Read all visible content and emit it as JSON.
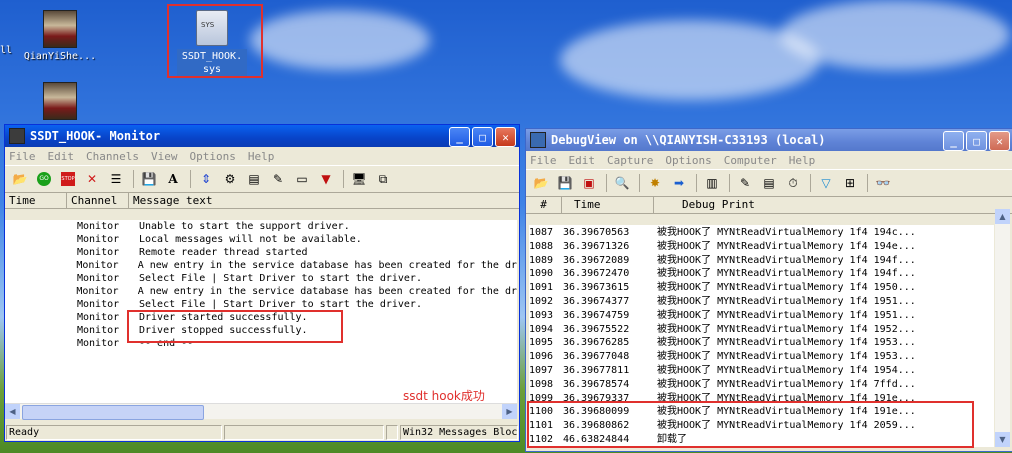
{
  "desktop": {
    "icons": [
      {
        "label": "QianYiShe..."
      },
      {
        "label": "SSDT_HOOK.sys"
      }
    ],
    "edge_label": "ll"
  },
  "monitor": {
    "title": "SSDT_HOOK- Monitor",
    "menu": [
      "File",
      "Edit",
      "Channels",
      "View",
      "Options",
      "Help"
    ],
    "columns": [
      "Time",
      "Channel",
      "Message text"
    ],
    "rows": [
      {
        "channel": "Monitor",
        "text": "Unable to start the support driver."
      },
      {
        "channel": "Monitor",
        "text": "Local messages will not be available."
      },
      {
        "channel": "Monitor",
        "text": "Remote reader thread started"
      },
      {
        "channel": "Monitor",
        "text": "A new entry in the service database has been created for the dr"
      },
      {
        "channel": "Monitor",
        "text": "Select File | Start Driver to start the driver."
      },
      {
        "channel": "Monitor",
        "text": "A new entry in the service database has been created for the dr"
      },
      {
        "channel": "Monitor",
        "text": "Select File | Start Driver to start the driver."
      },
      {
        "channel": "Monitor",
        "text": "Driver started successfully."
      },
      {
        "channel": "Monitor",
        "text": "Driver stopped successfully."
      },
      {
        "channel": "Monitor",
        "text": " -- end --"
      }
    ],
    "status": [
      "Ready",
      "",
      "",
      "Win32 Messages Bloc"
    ]
  },
  "annotation": "ssdt hook成功",
  "debugview": {
    "title": "DebugView on \\\\QIANYISH-C33193 (local)",
    "menu": [
      "File",
      "Edit",
      "Capture",
      "Options",
      "Computer",
      "Help"
    ],
    "columns": [
      "#",
      "Time",
      "Debug Print"
    ],
    "rows": [
      {
        "num": "1087",
        "time": "36.39670563",
        "msg": "被我HOOK了 MYNtReadVirtualMemory 1f4 194c..."
      },
      {
        "num": "1088",
        "time": "36.39671326",
        "msg": "被我HOOK了 MYNtReadVirtualMemory 1f4 194e..."
      },
      {
        "num": "1089",
        "time": "36.39672089",
        "msg": "被我HOOK了 MYNtReadVirtualMemory 1f4 194f..."
      },
      {
        "num": "1090",
        "time": "36.39672470",
        "msg": "被我HOOK了 MYNtReadVirtualMemory 1f4 194f..."
      },
      {
        "num": "1091",
        "time": "36.39673615",
        "msg": "被我HOOK了 MYNtReadVirtualMemory 1f4 1950..."
      },
      {
        "num": "1092",
        "time": "36.39674377",
        "msg": "被我HOOK了 MYNtReadVirtualMemory 1f4 1951..."
      },
      {
        "num": "1093",
        "time": "36.39674759",
        "msg": "被我HOOK了 MYNtReadVirtualMemory 1f4 1951..."
      },
      {
        "num": "1094",
        "time": "36.39675522",
        "msg": "被我HOOK了 MYNtReadVirtualMemory 1f4 1952..."
      },
      {
        "num": "1095",
        "time": "36.39676285",
        "msg": "被我HOOK了 MYNtReadVirtualMemory 1f4 1953..."
      },
      {
        "num": "1096",
        "time": "36.39677048",
        "msg": "被我HOOK了 MYNtReadVirtualMemory 1f4 1953..."
      },
      {
        "num": "1097",
        "time": "36.39677811",
        "msg": "被我HOOK了 MYNtReadVirtualMemory 1f4 1954..."
      },
      {
        "num": "1098",
        "time": "36.39678574",
        "msg": "被我HOOK了 MYNtReadVirtualMemory 1f4 7ffd..."
      },
      {
        "num": "1099",
        "time": "36.39679337",
        "msg": "被我HOOK了 MYNtReadVirtualMemory 1f4 191e..."
      },
      {
        "num": "1100",
        "time": "36.39680099",
        "msg": "被我HOOK了 MYNtReadVirtualMemory 1f4 191e..."
      },
      {
        "num": "1101",
        "time": "36.39680862",
        "msg": "被我HOOK了 MYNtReadVirtualMemory 1f4 2059..."
      },
      {
        "num": "1102",
        "time": "46.63824844",
        "msg": "卸载了"
      }
    ]
  }
}
